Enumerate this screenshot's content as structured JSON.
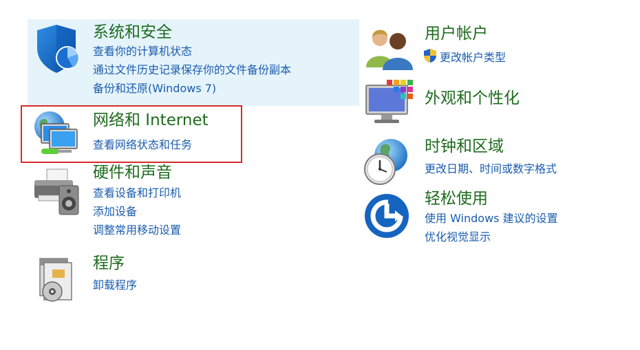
{
  "categories": {
    "system_security": {
      "title": "系统和安全",
      "links": [
        "查看你的计算机状态",
        "通过文件历史记录保存你的文件备份副本",
        "备份和还原(Windows 7)"
      ]
    },
    "network_internet": {
      "title": "网络和 Internet",
      "links": [
        "查看网络状态和任务"
      ]
    },
    "hardware_sound": {
      "title": "硬件和声音",
      "links": [
        "查看设备和打印机",
        "添加设备",
        "调整常用移动设置"
      ]
    },
    "programs": {
      "title": "程序",
      "links": [
        "卸载程序"
      ]
    },
    "user_accounts": {
      "title": "用户帐户",
      "links": [
        "更改帐户类型"
      ]
    },
    "appearance": {
      "title": "外观和个性化",
      "links": []
    },
    "clock_region": {
      "title": "时钟和区域",
      "links": [
        "更改日期、时间或数字格式"
      ]
    },
    "ease_of_access": {
      "title": "轻松使用",
      "links": [
        "使用 Windows 建议的设置",
        "优化视觉显示"
      ]
    }
  },
  "colors": {
    "title_green": "#1e6b1e",
    "link_blue": "#1a5cae",
    "hover_background": "#e5f3fb",
    "selection_outline": "#d82a2a"
  }
}
